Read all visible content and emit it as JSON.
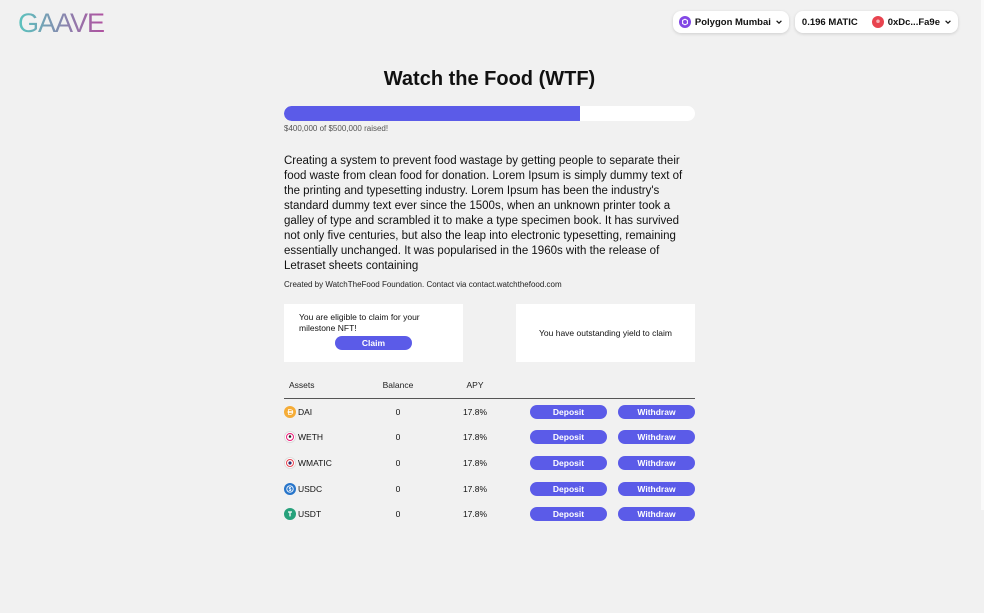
{
  "header": {
    "logo_text": "GAAVE",
    "network": {
      "label": "Polygon Mumbai",
      "icon": "polygon-icon"
    },
    "wallet": {
      "balance": "0.196 MATIC",
      "address": "0xDc...Fa9e",
      "icon": "avatar-icon"
    }
  },
  "project": {
    "title": "Watch the Food (WTF)",
    "progress_fraction": 0.8,
    "raised_text": "$400,000 of $500,000 raised!",
    "description": "Creating a system to prevent food wastage by getting people to separate their food waste from clean food for donation. Lorem Ipsum is simply dummy text of the printing and typesetting industry. Lorem Ipsum has been the industry's standard dummy text ever since the 1500s, when an unknown printer took a galley of type and scrambled it to make a type specimen book. It has survived not only five centuries, but also the leap into electronic typesetting, remaining essentially unchanged. It was popularised in the 1960s with the release of Letraset sheets containing",
    "created_by": "Created by WatchTheFood Foundation. Contact via contact.watchthefood.com"
  },
  "cards": {
    "claim": {
      "text": "You are eligible to claim for your milestone NFT!",
      "button": "Claim"
    },
    "yield": {
      "text": "You have outstanding yield to claim"
    }
  },
  "table": {
    "headers": {
      "assets": "Assets",
      "balance": "Balance",
      "apy": "APY"
    },
    "rows": [
      {
        "symbol": "DAI",
        "balance": "0",
        "apy": "17.8%",
        "deposit": "Deposit",
        "withdraw": "Withdraw",
        "icon": "dai-icon",
        "color": "#f5ac37"
      },
      {
        "symbol": "WETH",
        "balance": "0",
        "apy": "17.8%",
        "deposit": "Deposit",
        "withdraw": "Withdraw",
        "icon": "weth-icon",
        "color": "#ec1c79"
      },
      {
        "symbol": "WMATIC",
        "balance": "0",
        "apy": "17.8%",
        "deposit": "Deposit",
        "withdraw": "Withdraw",
        "icon": "wmatic-icon",
        "color": "#2d2b6e"
      },
      {
        "symbol": "USDC",
        "balance": "0",
        "apy": "17.8%",
        "deposit": "Deposit",
        "withdraw": "Withdraw",
        "icon": "usdc-icon",
        "color": "#2775ca"
      },
      {
        "symbol": "USDT",
        "balance": "0",
        "apy": "17.8%",
        "deposit": "Deposit",
        "withdraw": "Withdraw",
        "icon": "usdt-icon",
        "color": "#26a17b"
      }
    ]
  },
  "colors": {
    "accent": "#5b5be8",
    "background": "#f1f1f1",
    "logo_gradient": [
      "#5ac4be",
      "#b050a0"
    ]
  }
}
